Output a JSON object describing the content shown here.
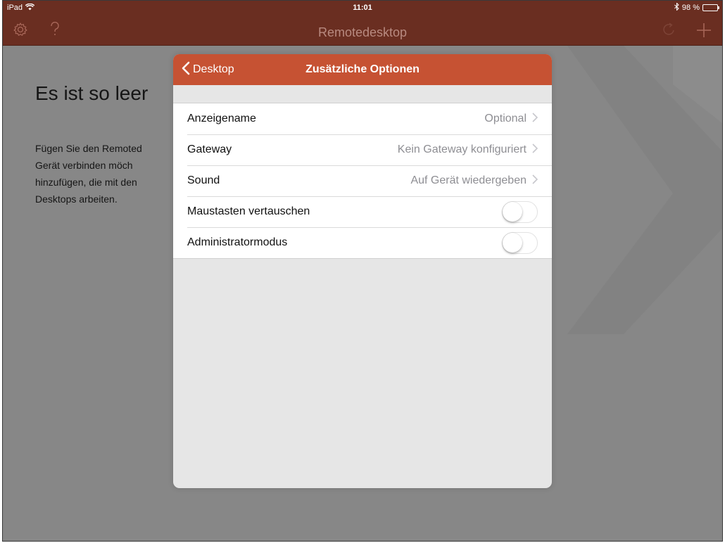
{
  "status": {
    "device": "iPad",
    "time": "11:01",
    "battery_text": "98 %",
    "battery_level": 0.98
  },
  "navbar": {
    "title": "Remotedesktop",
    "icons": [
      "gear-icon",
      "help-icon",
      "refresh-icon",
      "plus-icon"
    ]
  },
  "background": {
    "empty_title": "Es ist so leer",
    "empty_text": "Fügen Sie den Remoted\nGerät verbinden möch\nhinzufügen, die mit den\nDesktops arbeiten."
  },
  "modal": {
    "back_label": "Desktop",
    "title": "Zusätzliche Optionen",
    "rows": [
      {
        "label": "Anzeigename",
        "value": "Optional"
      },
      {
        "label": "Gateway",
        "value": "Kein Gateway konfiguriert"
      },
      {
        "label": "Sound",
        "value": "Auf Gerät wiedergeben"
      },
      {
        "label": "Maustasten vertauschen",
        "toggle": false
      },
      {
        "label": "Administratormodus",
        "toggle": false
      }
    ]
  },
  "colors": {
    "nav_bg": "#6a2e21",
    "modal_header": "#c65233",
    "backdrop": "#878787"
  }
}
